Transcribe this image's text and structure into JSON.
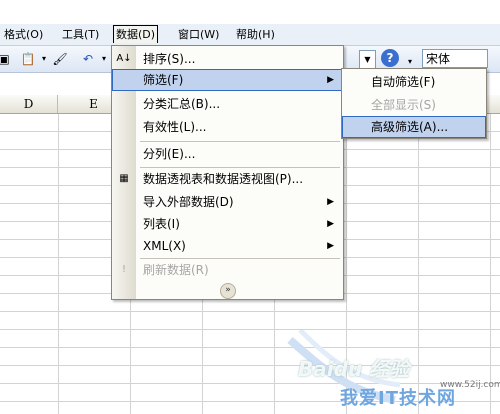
{
  "menubar": {
    "format": "格式(O)",
    "tools": "工具(T)",
    "data": "数据(D)",
    "window": "窗口(W)",
    "help": "帮助(H)"
  },
  "toolbar": {
    "help_glyph": "?",
    "font_name": "宋体"
  },
  "columns": [
    "D",
    "E"
  ],
  "data_menu": {
    "items": [
      {
        "label": "排序(S)...",
        "icon": "sort-az-icon"
      },
      {
        "label": "筛选(F)",
        "submenu": true
      },
      {
        "label": "分类汇总(B)..."
      },
      {
        "label": "有效性(L)..."
      },
      {
        "label": "分列(E)..."
      },
      {
        "label": "数据透视表和数据透视图(P)...",
        "icon": "pivot-table-icon"
      },
      {
        "label": "导入外部数据(D)",
        "submenu": true
      },
      {
        "label": "列表(I)",
        "submenu": true
      },
      {
        "label": "XML(X)",
        "submenu": true
      },
      {
        "label": "刷新数据(R)",
        "disabled": true,
        "icon": "refresh-icon"
      }
    ],
    "expand_glyph": "»"
  },
  "filter_submenu": {
    "items": [
      {
        "label": "自动筛选(F)"
      },
      {
        "label": "全部显示(S)",
        "disabled": true
      },
      {
        "label": "高级筛选(A)..."
      }
    ]
  },
  "watermark": {
    "logo": "Baidu 经验",
    "text": "我爱IT技术网",
    "url": "www.52ij.com"
  },
  "colors": {
    "menubar_bg": "#eaf0f8",
    "highlight": "#c1d2ee",
    "highlight_border": "#316ac5",
    "disabled_text": "#a6a6a6"
  }
}
